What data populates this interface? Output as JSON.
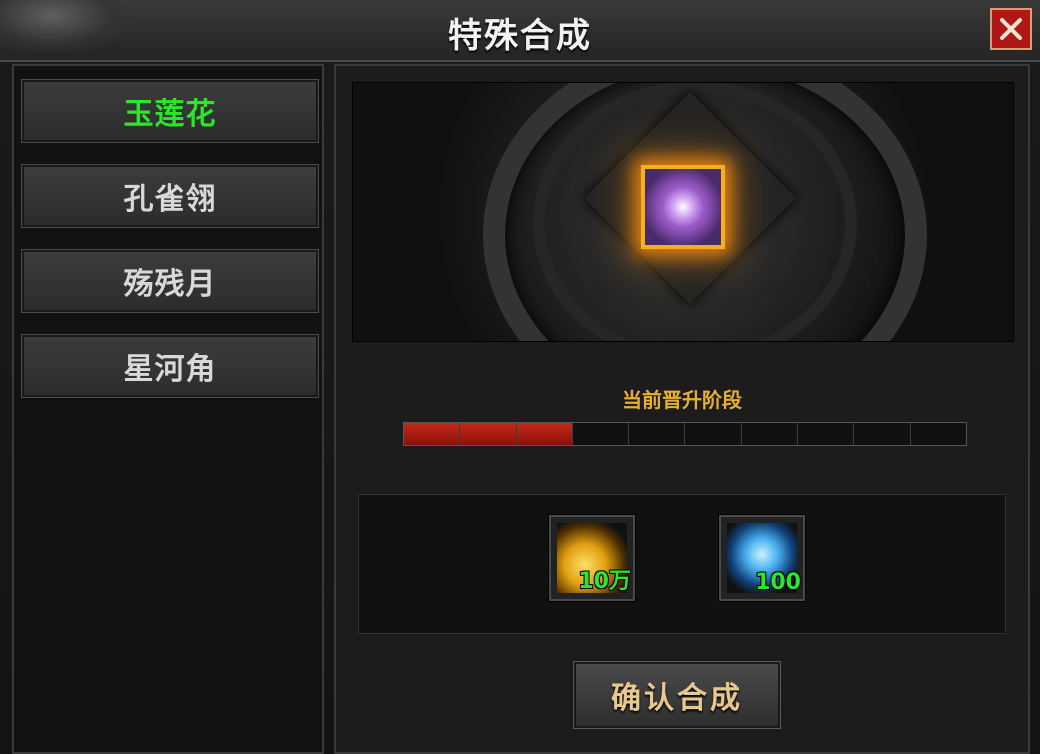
{
  "window": {
    "title": "特殊合成"
  },
  "sidebar": {
    "items": [
      {
        "label": "玉莲花",
        "active": true
      },
      {
        "label": "孔雀翎",
        "active": false
      },
      {
        "label": "殇残月",
        "active": false
      },
      {
        "label": "星河角",
        "active": false
      }
    ]
  },
  "main": {
    "banner": {
      "icon": "jade-lotus-gem-icon"
    },
    "stage_label": "当前晋升阶段",
    "progress": {
      "filled": 3,
      "total": 10
    },
    "costs": [
      {
        "icon": "gold-coins-icon",
        "amount": "10万"
      },
      {
        "icon": "blue-orb-icon",
        "amount": "100"
      }
    ],
    "confirm_label": "确认合成"
  },
  "colors": {
    "active_text": "#2be62b",
    "stage_label": "#e8b030",
    "progress_fill": "#c42a1a",
    "close_bg": "#b01818"
  }
}
